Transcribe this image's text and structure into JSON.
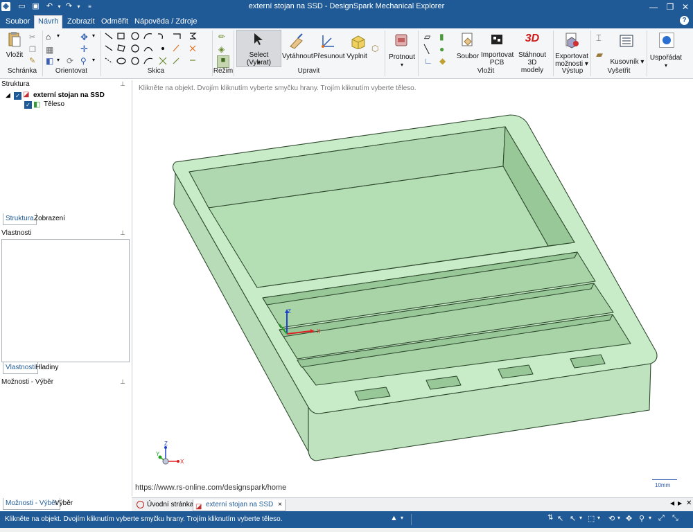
{
  "window": {
    "title": "externí stojan na SSD - DesignSpark Mechanical Explorer",
    "controls": {
      "minimize": "—",
      "restore": "❐",
      "close": "✕",
      "help": "?"
    }
  },
  "menu": {
    "tabs": [
      "Soubor",
      "Návrh",
      "Zobrazit",
      "Odměřit",
      "Nápověda / Zdroje"
    ],
    "active": "Návrh"
  },
  "ribbon": {
    "groups": {
      "schranka": "Schránka",
      "orientovat": "Orientovat",
      "skica": "Skica",
      "rezim": "Režim",
      "upravit": "Upravit",
      "vlozit": "Vložit",
      "vystup": "Výstup",
      "vysetrit": "Vyšetřit"
    },
    "buttons": {
      "vlozit_paste": "Vložit",
      "select": "Select (Vybrat)",
      "vytahnout": "Vytáhnout",
      "presunout": "Přesunout",
      "vyplnit": "Vyplnit",
      "protnout": "Protnout",
      "soubor": "Soubor",
      "importovat_pcb_1": "Importovat",
      "importovat_pcb_2": "PCB",
      "stahnout_1": "Stáhnout 3D",
      "stahnout_2": "modely",
      "stahnout_icon": "3D",
      "exportovat_1": "Exportovat",
      "exportovat_2": "možnosti",
      "kusovnik": "Kusovník",
      "usporadat": "Uspořádat"
    }
  },
  "left_panel": {
    "struktura_header": "Struktura",
    "tree": {
      "root": "externí stojan na SSD",
      "child": "Těleso"
    },
    "tabs_top": [
      "Struktura",
      "Zobrazení"
    ],
    "vlastnosti_header": "Vlastnosti",
    "tabs_mid": [
      "Vlastnosti",
      "Hladiny"
    ],
    "moznosti_header": "Možnosti - Výběr",
    "tabs_bottom": [
      "Možnosti - Výběr",
      "Výběr"
    ]
  },
  "viewport": {
    "hint": "Klikněte na objekt. Dvojím kliknutím vyberte smyčku hrany. Trojím kliknutím vyberte těleso.",
    "url": "https://www.rs-online.com/designspark/home",
    "scale": "10mm",
    "axis_x": "X",
    "axis_z": "Z",
    "axis_y": "Y",
    "model_color": "#c8ecc8"
  },
  "doc_tabs": {
    "tabs": [
      "Úvodní stránka",
      "externí stojan na SSD"
    ],
    "close": "×"
  },
  "status_bar": {
    "message": "Klikněte na objekt. Dvojím kliknutím vyberte smyčku hrany. Trojím kliknutím vyberte těleso."
  }
}
